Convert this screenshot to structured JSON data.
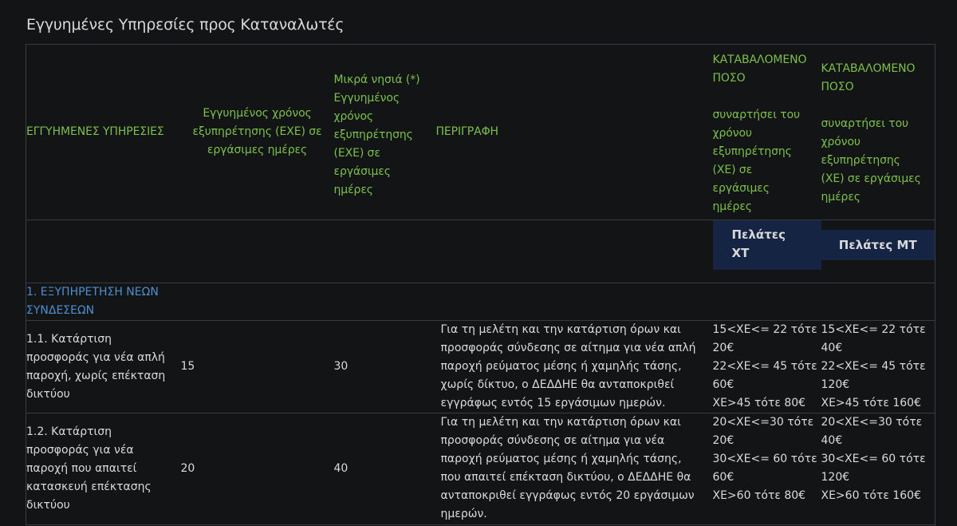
{
  "page": {
    "title": "Εγγυημένες Υπηρεσίες προς Καταναλωτές"
  },
  "headers": {
    "services": "ΕΓΓΥΗΜΕΝΕΣ ΥΠΗΡΕΣΙΕΣ",
    "guaranteed_time": [
      "Εγγυημένος χρόνος",
      "εξυπηρέτησης (ΕΧΕ) σε",
      "εργάσιμες ημέρες"
    ],
    "islands_time": [
      "Μικρά νησιά (*)",
      "Εγγυημένος",
      "χρόνος",
      "εξυπηρέτησης",
      "(ΕΧΕ) σε",
      "εργάσιμες",
      "ημέρες"
    ],
    "description": "ΠΕΡΙΓΡΑΦΗ",
    "amount_xt": {
      "title": [
        "ΚΑΤΑΒΑΛΟΜΕΝΟ",
        "ΠΟΣΟ"
      ],
      "subtitle": [
        "συναρτήσει του",
        "χρόνου",
        "εξυπηρέτησης",
        "(ΧΕ) σε",
        "εργάσιμες",
        "ημέρες"
      ]
    },
    "amount_mt": {
      "title": [
        "ΚΑΤΑΒΑΛΟΜΕΝΟ",
        "ΠΟΣΟ"
      ],
      "subtitle": [
        "συναρτήσει του",
        "χρόνου",
        "εξυπηρέτησης",
        "(ΧΕ) σε εργάσιμες",
        "ημέρες"
      ]
    }
  },
  "customers": {
    "xt": [
      "Πελάτες",
      "ΧΤ"
    ],
    "mt": "Πελάτες ΜΤ"
  },
  "sections": [
    {
      "title": [
        "1. ΕΞΥΠΗΡΕΤΗΣΗ ΝΕΩΝ",
        "ΣΥΝΔΕΣΕΩΝ"
      ]
    }
  ],
  "rows": [
    {
      "name": [
        "1.1. Κατάρτιση",
        "προσφοράς για νέα απλή",
        "παροχή, χωρίς επέκταση",
        "δικτύου"
      ],
      "time": "15",
      "islands_time": "30",
      "description": [
        "Για τη μελέτη και την κατάρτιση όρων και",
        "προσφοράς σύνδεσης σε αίτημα για νέα απλή",
        "παροχή ρεύματος μέσης ή χαμηλής τάσης,",
        "χωρίς δίκτυο, ο ΔΕΔΔΗΕ θα ανταποκριθεί",
        "εγγράφως εντός 15 εργάσιμων ημερών."
      ],
      "amount_xt": [
        "15<ΧΕ<= 22 τότε",
        "20€",
        "22<ΧΕ<= 45 τότε",
        "60€",
        "ΧΕ>45 τότε 80€"
      ],
      "amount_mt": [
        "15<ΧΕ<= 22 τότε",
        "40€",
        "22<ΧΕ<= 45 τότε",
        "120€",
        "ΧΕ>45 τότε 160€"
      ]
    },
    {
      "name": [
        "1.2. Κατάρτιση",
        "προσφοράς για νέα",
        "παροχή που απαιτεί",
        "κατασκευή επέκτασης",
        "δικτύου"
      ],
      "time": "20",
      "islands_time": "40",
      "description": [
        "Για τη μελέτη και την κατάρτιση όρων και",
        "προσφοράς σύνδεσης σε αίτημα για νέα",
        "παροχή ρεύματος μέσης ή χαμηλής τάσης,",
        "που απαιτεί επέκταση δικτύου, ο ΔΕΔΔΗΕ θα",
        "ανταποκριθεί εγγράφως εντός 20 εργάσιμων",
        "ημερών."
      ],
      "amount_xt": [
        "20<ΧΕ<=30 τότε",
        "20€",
        "30<ΧΕ<= 60 τότε",
        "60€",
        "ΧΕ>60 τότε 80€"
      ],
      "amount_mt": [
        "20<ΧΕ<=30 τότε",
        "40€",
        "30<ΧΕ<= 60 τότε",
        "120€",
        "ΧΕ>60 τότε 160€"
      ]
    }
  ],
  "colors": {
    "background": "#131416",
    "header_green": "#7cc04b",
    "section_blue": "#4d8fd0",
    "badge_bg": "#162444",
    "border": "#3a3b3e"
  }
}
